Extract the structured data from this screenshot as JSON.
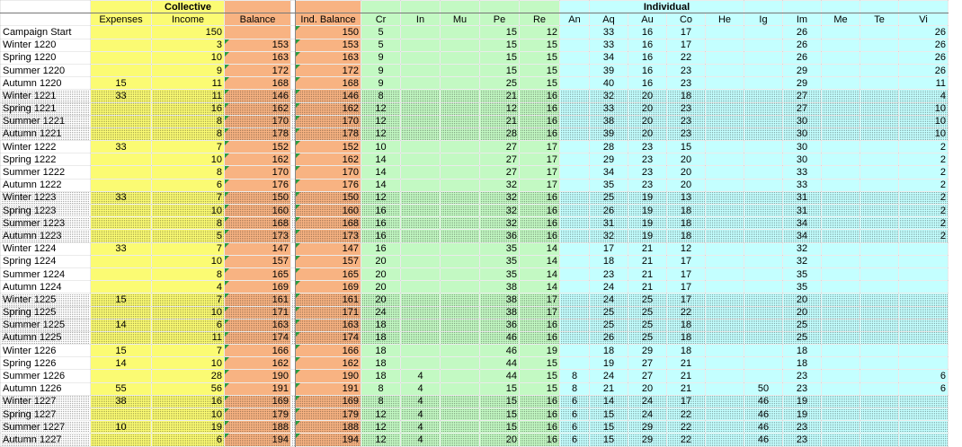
{
  "headers": {
    "collective": "Collective",
    "individual": "Individual",
    "columns": [
      "Expenses",
      "Income",
      "Balance",
      "Ind. Balance",
      "Cr",
      "In",
      "Mu",
      "Pe",
      "Re",
      "An",
      "Aq",
      "Au",
      "Co",
      "He",
      "Ig",
      "Im",
      "Me",
      "Te",
      "Vi"
    ]
  },
  "rows": [
    {
      "label": "Campaign Start",
      "shaded": false,
      "cells": [
        "",
        "150",
        "",
        "150",
        "5",
        "",
        "",
        "15",
        "12",
        "",
        "33",
        "16",
        "17",
        "",
        "",
        "26",
        "",
        "",
        "26"
      ]
    },
    {
      "label": "Winter 1220",
      "shaded": false,
      "cells": [
        "",
        "3",
        "153",
        "153",
        "5",
        "",
        "",
        "15",
        "15",
        "",
        "33",
        "16",
        "17",
        "",
        "",
        "26",
        "",
        "",
        "26"
      ]
    },
    {
      "label": "Spring 1220",
      "shaded": false,
      "cells": [
        "",
        "10",
        "163",
        "163",
        "9",
        "",
        "",
        "15",
        "15",
        "",
        "34",
        "16",
        "22",
        "",
        "",
        "26",
        "",
        "",
        "26"
      ]
    },
    {
      "label": "Summer 1220",
      "shaded": false,
      "cells": [
        "",
        "9",
        "172",
        "172",
        "9",
        "",
        "",
        "15",
        "15",
        "",
        "39",
        "16",
        "23",
        "",
        "",
        "29",
        "",
        "",
        "26"
      ]
    },
    {
      "label": "Autumn 1220",
      "shaded": false,
      "cells": [
        "15",
        "11",
        "168",
        "168",
        "9",
        "",
        "",
        "25",
        "15",
        "",
        "40",
        "16",
        "23",
        "",
        "",
        "29",
        "",
        "",
        "11"
      ]
    },
    {
      "label": "Winter 1221",
      "shaded": true,
      "cells": [
        "33",
        "11",
        "146",
        "146",
        "8",
        "",
        "",
        "21",
        "16",
        "",
        "32",
        "20",
        "18",
        "",
        "",
        "27",
        "",
        "",
        "4"
      ]
    },
    {
      "label": "Spring 1221",
      "shaded": true,
      "cells": [
        "",
        "16",
        "162",
        "162",
        "12",
        "",
        "",
        "12",
        "16",
        "",
        "33",
        "20",
        "23",
        "",
        "",
        "27",
        "",
        "",
        "10"
      ]
    },
    {
      "label": "Summer 1221",
      "shaded": true,
      "cells": [
        "",
        "8",
        "170",
        "170",
        "12",
        "",
        "",
        "21",
        "16",
        "",
        "38",
        "20",
        "23",
        "",
        "",
        "30",
        "",
        "",
        "10"
      ]
    },
    {
      "label": "Autumn 1221",
      "shaded": true,
      "cells": [
        "",
        "8",
        "178",
        "178",
        "12",
        "",
        "",
        "28",
        "16",
        "",
        "39",
        "20",
        "23",
        "",
        "",
        "30",
        "",
        "",
        "10"
      ]
    },
    {
      "label": "Winter 1222",
      "shaded": false,
      "cells": [
        "33",
        "7",
        "152",
        "152",
        "10",
        "",
        "",
        "27",
        "17",
        "",
        "28",
        "23",
        "15",
        "",
        "",
        "30",
        "",
        "",
        "2"
      ]
    },
    {
      "label": "Spring 1222",
      "shaded": false,
      "cells": [
        "",
        "10",
        "162",
        "162",
        "14",
        "",
        "",
        "27",
        "17",
        "",
        "29",
        "23",
        "20",
        "",
        "",
        "30",
        "",
        "",
        "2"
      ]
    },
    {
      "label": "Summer 1222",
      "shaded": false,
      "cells": [
        "",
        "8",
        "170",
        "170",
        "14",
        "",
        "",
        "27",
        "17",
        "",
        "34",
        "23",
        "20",
        "",
        "",
        "33",
        "",
        "",
        "2"
      ]
    },
    {
      "label": "Autumn 1222",
      "shaded": false,
      "cells": [
        "",
        "6",
        "176",
        "176",
        "14",
        "",
        "",
        "32",
        "17",
        "",
        "35",
        "23",
        "20",
        "",
        "",
        "33",
        "",
        "",
        "2"
      ]
    },
    {
      "label": "Winter 1223",
      "shaded": true,
      "cells": [
        "33",
        "7",
        "150",
        "150",
        "12",
        "",
        "",
        "32",
        "16",
        "",
        "25",
        "19",
        "13",
        "",
        "",
        "31",
        "",
        "",
        "2"
      ]
    },
    {
      "label": "Spring 1223",
      "shaded": true,
      "cells": [
        "",
        "10",
        "160",
        "160",
        "16",
        "",
        "",
        "32",
        "16",
        "",
        "26",
        "19",
        "18",
        "",
        "",
        "31",
        "",
        "",
        "2"
      ]
    },
    {
      "label": "Summer 1223",
      "shaded": true,
      "cells": [
        "",
        "8",
        "168",
        "168",
        "16",
        "",
        "",
        "32",
        "16",
        "",
        "31",
        "19",
        "18",
        "",
        "",
        "34",
        "",
        "",
        "2"
      ]
    },
    {
      "label": "Autumn 1223",
      "shaded": true,
      "cells": [
        "",
        "5",
        "173",
        "173",
        "16",
        "",
        "",
        "36",
        "16",
        "",
        "32",
        "19",
        "18",
        "",
        "",
        "34",
        "",
        "",
        "2"
      ]
    },
    {
      "label": "Winter 1224",
      "shaded": false,
      "cells": [
        "33",
        "7",
        "147",
        "147",
        "16",
        "",
        "",
        "35",
        "14",
        "",
        "17",
        "21",
        "12",
        "",
        "",
        "32",
        "",
        "",
        ""
      ]
    },
    {
      "label": "Spring 1224",
      "shaded": false,
      "cells": [
        "",
        "10",
        "157",
        "157",
        "20",
        "",
        "",
        "35",
        "14",
        "",
        "18",
        "21",
        "17",
        "",
        "",
        "32",
        "",
        "",
        ""
      ]
    },
    {
      "label": "Summer 1224",
      "shaded": false,
      "cells": [
        "",
        "8",
        "165",
        "165",
        "20",
        "",
        "",
        "35",
        "14",
        "",
        "23",
        "21",
        "17",
        "",
        "",
        "35",
        "",
        "",
        ""
      ]
    },
    {
      "label": "Autumn 1224",
      "shaded": false,
      "cells": [
        "",
        "4",
        "169",
        "169",
        "20",
        "",
        "",
        "38",
        "14",
        "",
        "24",
        "21",
        "17",
        "",
        "",
        "35",
        "",
        "",
        ""
      ]
    },
    {
      "label": "Winter 1225",
      "shaded": true,
      "cells": [
        "15",
        "7",
        "161",
        "161",
        "20",
        "",
        "",
        "38",
        "17",
        "",
        "24",
        "25",
        "17",
        "",
        "",
        "20",
        "",
        "",
        ""
      ]
    },
    {
      "label": "Spring 1225",
      "shaded": true,
      "cells": [
        "",
        "10",
        "171",
        "171",
        "24",
        "",
        "",
        "38",
        "17",
        "",
        "25",
        "25",
        "22",
        "",
        "",
        "20",
        "",
        "",
        ""
      ]
    },
    {
      "label": "Summer 1225",
      "shaded": true,
      "cells": [
        "14",
        "6",
        "163",
        "163",
        "18",
        "",
        "",
        "36",
        "16",
        "",
        "25",
        "25",
        "18",
        "",
        "",
        "25",
        "",
        "",
        ""
      ]
    },
    {
      "label": "Autumn 1225",
      "shaded": true,
      "cells": [
        "",
        "11",
        "174",
        "174",
        "18",
        "",
        "",
        "46",
        "16",
        "",
        "26",
        "25",
        "18",
        "",
        "",
        "25",
        "",
        "",
        ""
      ]
    },
    {
      "label": "Winter 1226",
      "shaded": false,
      "cells": [
        "15",
        "7",
        "166",
        "166",
        "18",
        "",
        "",
        "46",
        "19",
        "",
        "18",
        "29",
        "18",
        "",
        "",
        "18",
        "",
        "",
        ""
      ]
    },
    {
      "label": "Spring 1226",
      "shaded": false,
      "cells": [
        "14",
        "10",
        "162",
        "162",
        "18",
        "",
        "",
        "44",
        "15",
        "",
        "19",
        "27",
        "21",
        "",
        "",
        "18",
        "",
        "",
        ""
      ]
    },
    {
      "label": "Summer 1226",
      "shaded": false,
      "cells": [
        "",
        "28",
        "190",
        "190",
        "18",
        "4",
        "",
        "44",
        "15",
        "8",
        "24",
        "27",
        "21",
        "",
        "",
        "23",
        "",
        "",
        "6"
      ]
    },
    {
      "label": "Autumn 1226",
      "shaded": false,
      "cells": [
        "55",
        "56",
        "191",
        "191",
        "8",
        "4",
        "",
        "15",
        "15",
        "8",
        "21",
        "20",
        "21",
        "",
        "50",
        "23",
        "",
        "",
        "6"
      ]
    },
    {
      "label": "Winter 1227",
      "shaded": true,
      "cells": [
        "38",
        "16",
        "169",
        "169",
        "8",
        "4",
        "",
        "15",
        "16",
        "6",
        "14",
        "24",
        "17",
        "",
        "46",
        "19",
        "",
        "",
        ""
      ]
    },
    {
      "label": "Spring 1227",
      "shaded": true,
      "cells": [
        "",
        "10",
        "179",
        "179",
        "12",
        "4",
        "",
        "15",
        "16",
        "6",
        "15",
        "24",
        "22",
        "",
        "46",
        "19",
        "",
        "",
        ""
      ]
    },
    {
      "label": "Summer 1227",
      "shaded": true,
      "cells": [
        "10",
        "19",
        "188",
        "188",
        "12",
        "4",
        "",
        "15",
        "16",
        "6",
        "15",
        "29",
        "22",
        "",
        "46",
        "23",
        "",
        "",
        ""
      ]
    },
    {
      "label": "Autumn 1227",
      "shaded": true,
      "cells": [
        "",
        "6",
        "194",
        "194",
        "12",
        "4",
        "",
        "20",
        "16",
        "6",
        "15",
        "29",
        "22",
        "",
        "46",
        "23",
        "",
        "",
        ""
      ]
    }
  ]
}
